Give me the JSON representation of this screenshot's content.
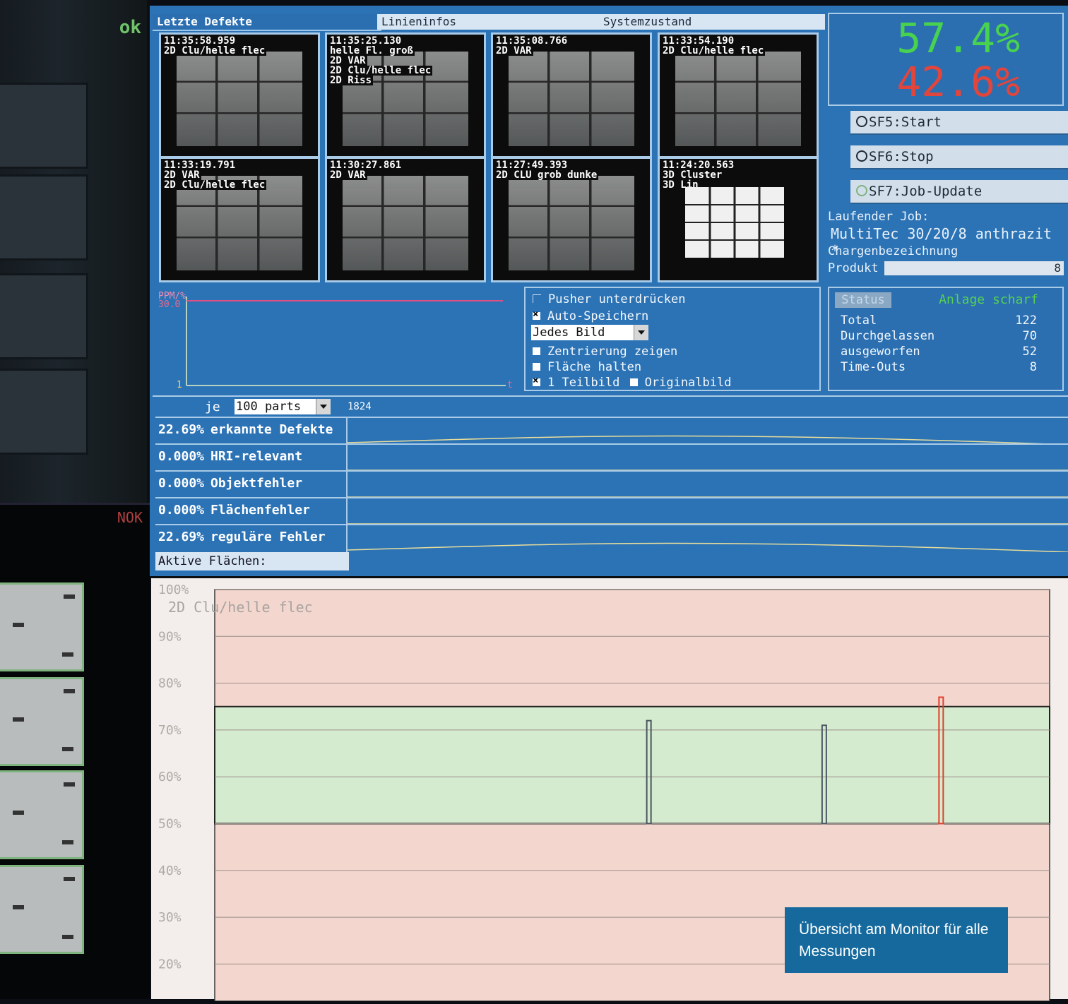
{
  "camera": {
    "ok_label": "ok",
    "nok_label": "NOK"
  },
  "tabs": [
    "Letzte Defekte",
    "Linieninfos",
    "Systemzustand"
  ],
  "thumbnails": [
    {
      "lines": [
        "11:35:58.959",
        "2D Clu/helle flec"
      ]
    },
    {
      "lines": [
        "11:35:25.130",
        "helle Fl. groß",
        "2D VAR",
        "2D Clu/helle flec",
        "2D Riss"
      ]
    },
    {
      "lines": [
        "11:35:08.766",
        "2D VAR"
      ]
    },
    {
      "lines": [
        "11:33:54.190",
        "2D Clu/helle flec"
      ]
    },
    {
      "lines": [
        "11:33:19.791",
        "2D VAR",
        "2D Clu/helle flec"
      ]
    },
    {
      "lines": [
        "11:30:27.861",
        "2D VAR"
      ]
    },
    {
      "lines": [
        "11:27:49.393",
        "2D CLU grob dunke"
      ]
    },
    {
      "lines": [
        "11:24:20.563",
        "3D Cluster",
        "3D Lin"
      ]
    }
  ],
  "percentages": {
    "pass": "57.4%",
    "fail": "42.6%",
    "pass_color": "#49d24f",
    "fail_color": "#e2453c"
  },
  "buttons": {
    "start": "SF5:Start",
    "stop": "SF6:Stop",
    "job_update": "SF7:Job-Update"
  },
  "job": {
    "running_label": "Laufender Job:",
    "running_value": "MultiTec 30/20/8 anthrazit *",
    "batch_label": "Chargenbezeichnung",
    "product_label": "Produkt",
    "product_value": "8"
  },
  "ppm": {
    "label": "PPM/%",
    "value": "30.0",
    "y_min": "1",
    "x_axis": "t"
  },
  "options": {
    "pusher": "Pusher unterdrücken",
    "auto_save": "Auto-Speichern",
    "save_mode": "Jedes Bild",
    "centering": "Zentrierung zeigen",
    "hold_area": "Fläche halten",
    "partial_count": "1",
    "partial_label": "Teilbild",
    "original_label": "Originalbild"
  },
  "status": {
    "label": "Status",
    "state": "Anlage scharf",
    "rows": [
      {
        "label": "Total",
        "value": "122"
      },
      {
        "label": "Durchgelassen",
        "value": "70"
      },
      {
        "label": "ausgeworfen",
        "value": "52"
      },
      {
        "label": "Time-Outs",
        "value": "8"
      }
    ]
  },
  "defects": {
    "je_label": "je",
    "per_value": "100 parts",
    "axis_start": "1824",
    "rows": [
      {
        "pct": "22.69%",
        "label": "erkannte Defekte"
      },
      {
        "pct": "0.000%",
        "label": "HRI-relevant"
      },
      {
        "pct": "0.000%",
        "label": "Objektfehler"
      },
      {
        "pct": "0.000%",
        "label": "Flächenfehler"
      },
      {
        "pct": "22.69%",
        "label": "reguläre Fehler"
      }
    ],
    "active_label": "Aktive Flächen:"
  },
  "chart_data": {
    "type": "bar",
    "title": "2D Clu/helle flec",
    "y_ticks": [
      "100%",
      "90%",
      "80%",
      "70%",
      "60%",
      "50%",
      "40%",
      "30%",
      "20%"
    ],
    "ylim": [
      20,
      100
    ],
    "green_band": [
      50,
      75
    ],
    "bars": [
      {
        "x": 0.52,
        "value": 72,
        "color": "#4a5560"
      },
      {
        "x": 0.73,
        "value": 71,
        "color": "#4a5560"
      },
      {
        "x": 0.87,
        "value": 77,
        "color": "#e0402c"
      }
    ]
  },
  "caption": "Übersicht am Monitor für alle Messungen"
}
